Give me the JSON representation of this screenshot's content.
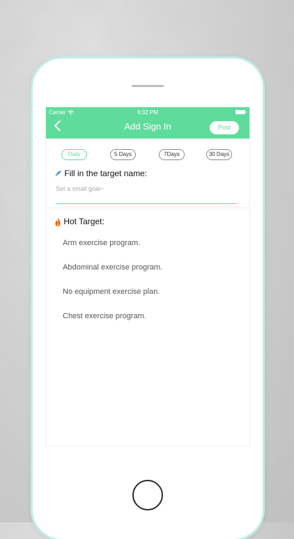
{
  "status": {
    "carrier": "Carrier",
    "time": "6:02 PM"
  },
  "nav": {
    "title": "Add Sign In",
    "post": "Post"
  },
  "tabs": [
    "Daily",
    "5 Days",
    "7Days",
    "30 Days"
  ],
  "active_tab": "Daily",
  "form": {
    "label": "Fill in the target name:",
    "placeholder": "Set a small goal~"
  },
  "hot": {
    "label": "Hot Target:",
    "items": [
      "Arm exercise program.",
      "Abdominal exercise program.",
      "No equipment exercise plan.",
      "Chest exercise program."
    ]
  },
  "colors": {
    "accent": "#5fdc9c",
    "phone_border": "#bfeee7",
    "text": "#111111"
  }
}
